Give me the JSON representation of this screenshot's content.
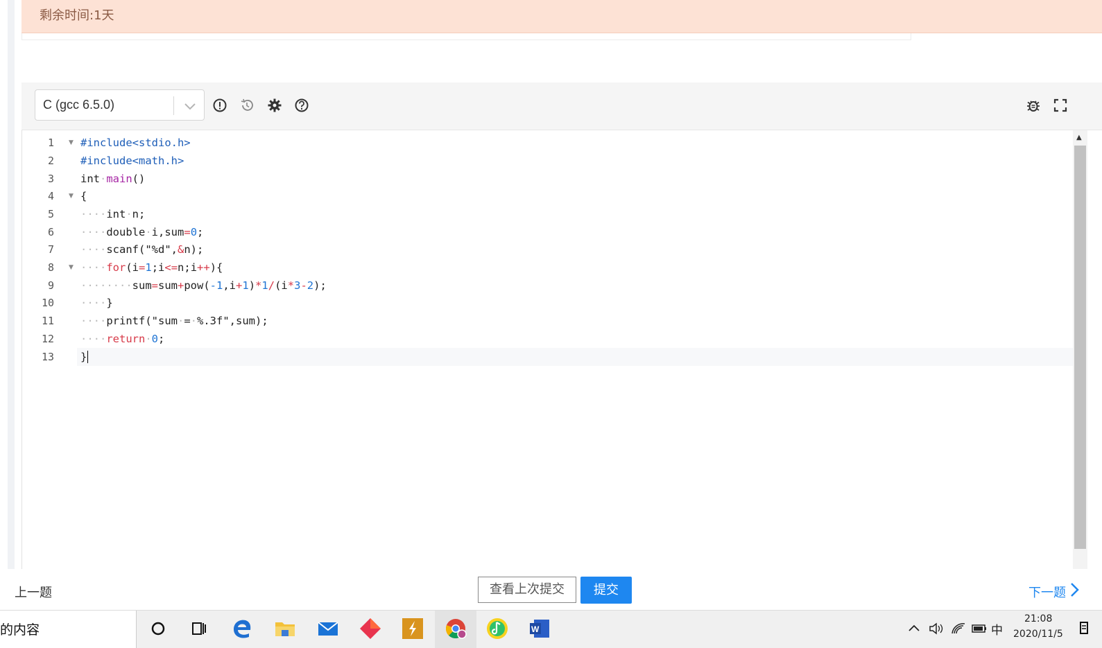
{
  "banner": {
    "remaining_time": "剩余时间:1天"
  },
  "toolbar": {
    "language": "C (gcc 6.5.0)"
  },
  "editor": {
    "line_numbers": [
      "1",
      "2",
      "3",
      "4",
      "5",
      "6",
      "7",
      "8",
      "9",
      "10",
      "11",
      "12",
      "13"
    ]
  },
  "bottom": {
    "prev": "上一题",
    "view_last": "查看上次提交",
    "submit": "提交",
    "next": "下一题"
  },
  "taskbar": {
    "search_text": "的内容",
    "ime": "中",
    "time": "21:08",
    "date": "2020/11/5"
  },
  "colors": {
    "accent": "#1e87f0",
    "banner_bg": "#fde2d5",
    "keyword": "#a626a4",
    "operator": "#d73a49",
    "number": "#1f74d4"
  }
}
